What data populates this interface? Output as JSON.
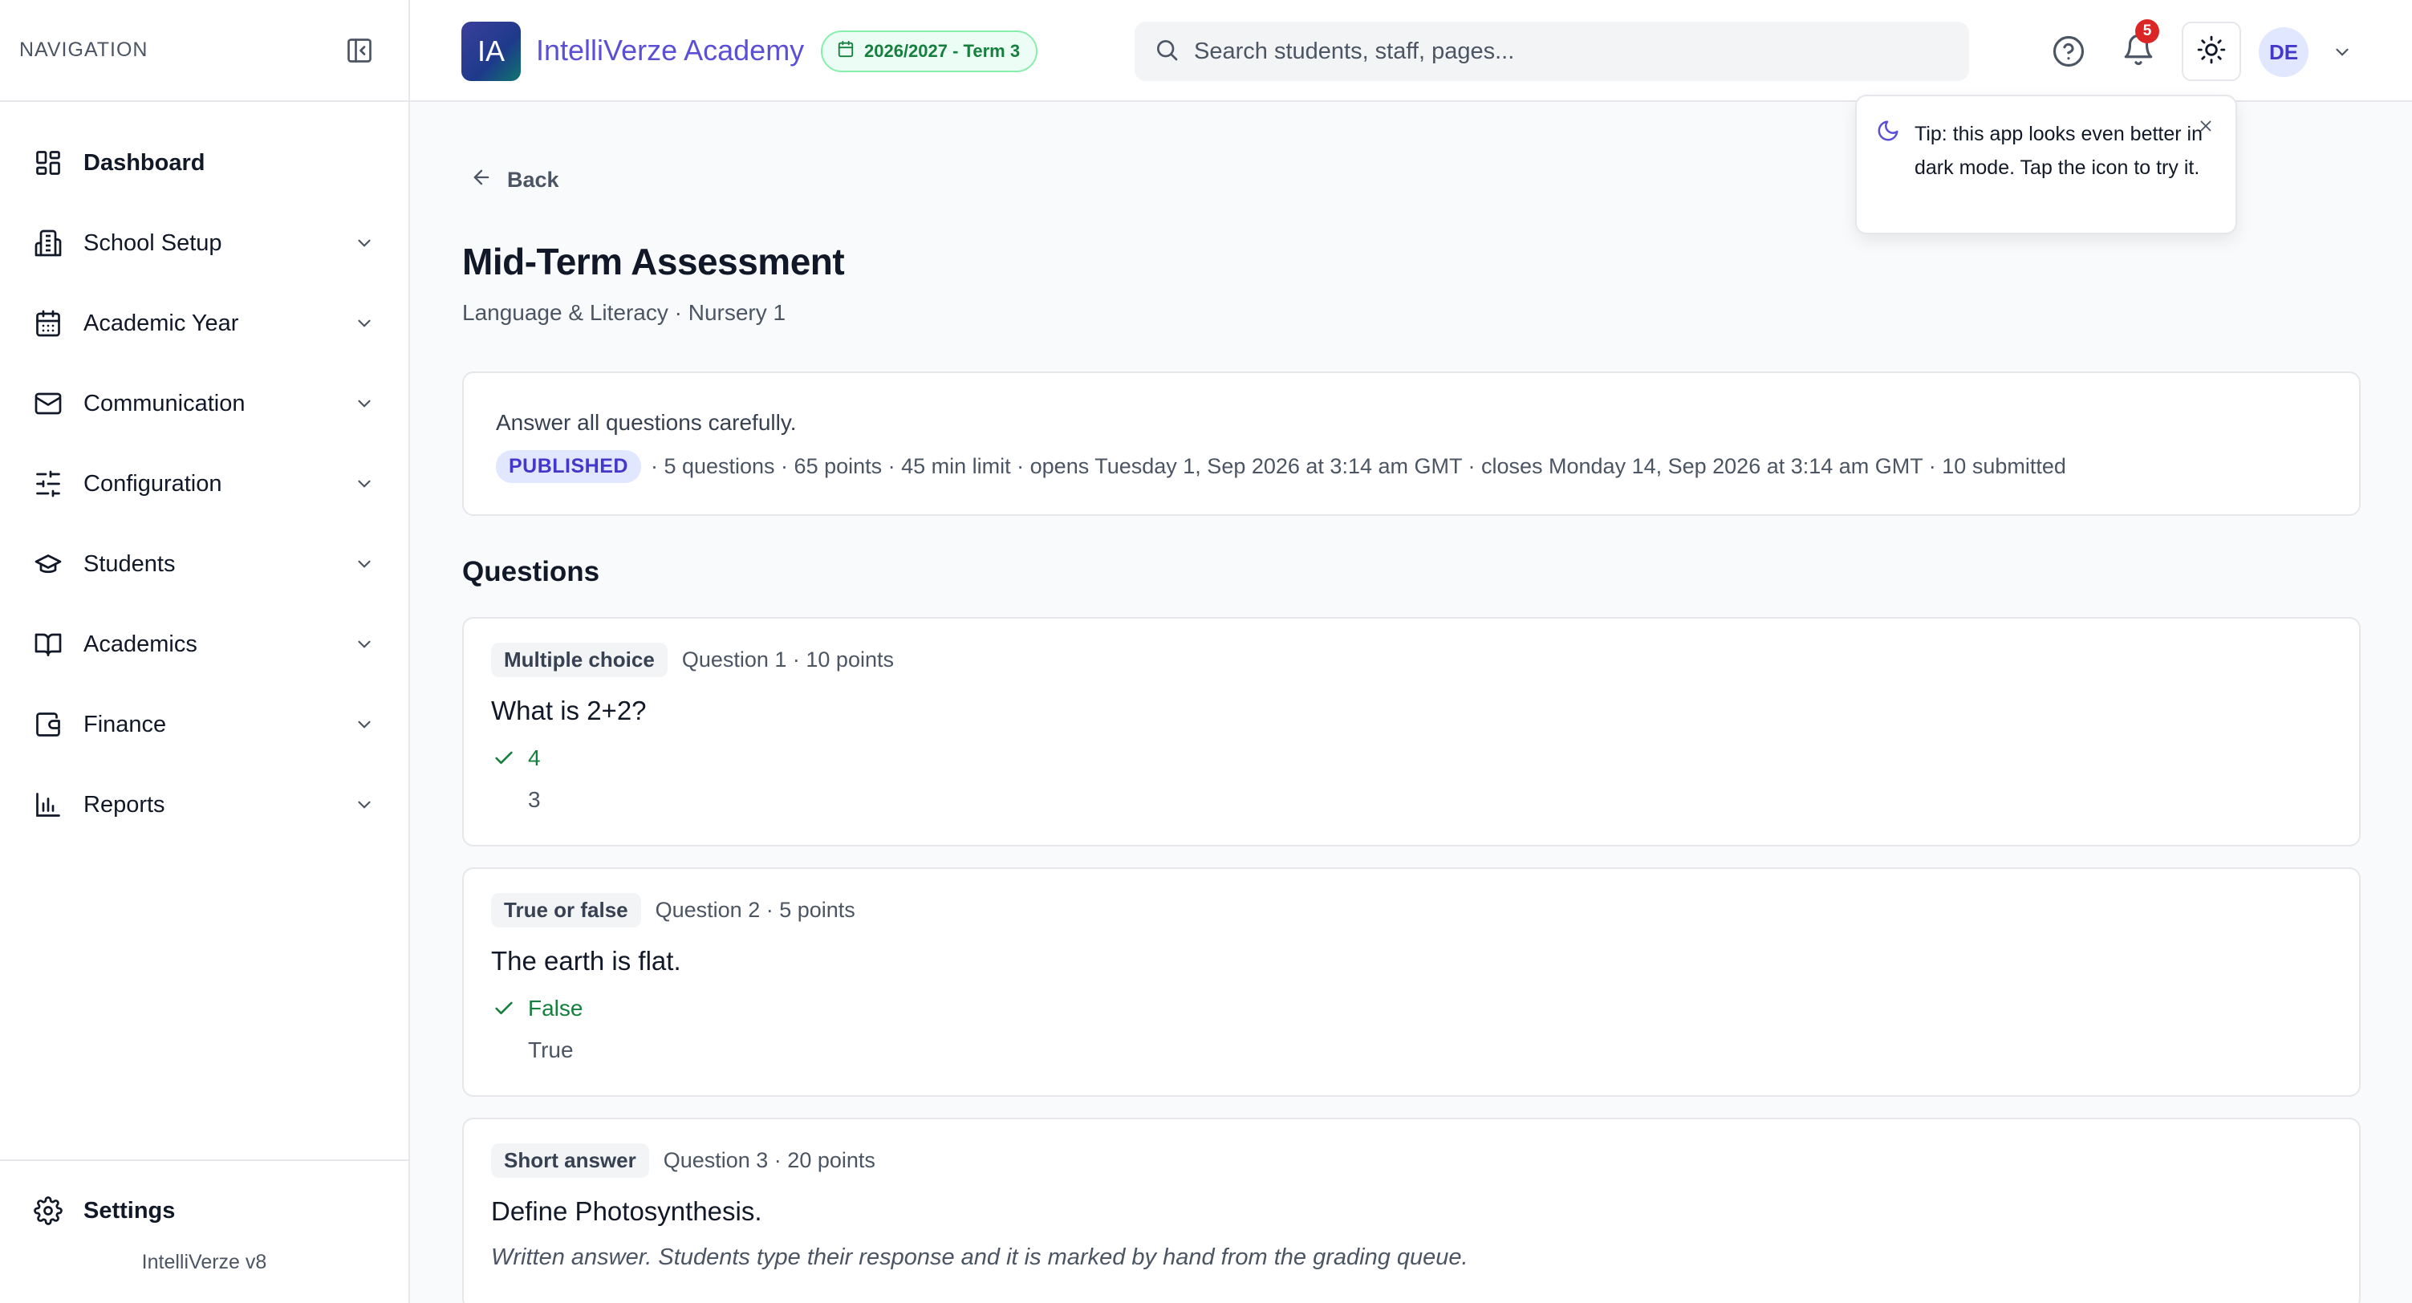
{
  "sidebar": {
    "title": "NAVIGATION",
    "items": [
      {
        "label": "Dashboard",
        "icon": "dashboard-icon"
      },
      {
        "label": "School Setup",
        "icon": "building-icon"
      },
      {
        "label": "Academic Year",
        "icon": "calendar-icon"
      },
      {
        "label": "Communication",
        "icon": "mail-icon"
      },
      {
        "label": "Configuration",
        "icon": "sliders-icon"
      },
      {
        "label": "Students",
        "icon": "graduation-cap-icon"
      },
      {
        "label": "Academics",
        "icon": "book-icon"
      },
      {
        "label": "Finance",
        "icon": "wallet-icon"
      },
      {
        "label": "Reports",
        "icon": "bar-chart-icon"
      }
    ],
    "settings_label": "Settings",
    "version": "IntelliVerze v8"
  },
  "header": {
    "logo_text": "IA",
    "app_name": "IntelliVerze Academy",
    "term": "2026/2027 - Term 3",
    "search_placeholder": "Search students, staff, pages...",
    "notification_count": "5",
    "avatar_initials": "DE",
    "colors": {
      "brand": "#5b4fd6",
      "term_green": "#15803d",
      "badge_red": "#dc2626"
    }
  },
  "tooltip": {
    "text": "Tip: this app looks even better in dark mode. Tap the icon to try it."
  },
  "page": {
    "back_label": "Back",
    "title": "Mid-Term Assessment",
    "subtitle": "Language & Literacy · Nursery 1",
    "description": "Answer all questions carefully.",
    "status": "PUBLISHED",
    "meta": "· 5 questions · 65 points · 45 min limit · opens Tuesday 1, Sep 2026 at 3:14 am GMT · closes Monday 14, Sep 2026 at 3:14 am GMT · 10 submitted",
    "questions_heading": "Questions"
  },
  "questions": [
    {
      "type": "Multiple choice",
      "meta": "Question 1 · 10 points",
      "text": "What is 2+2?",
      "options": [
        {
          "label": "4",
          "correct": true
        },
        {
          "label": "3",
          "correct": false
        }
      ]
    },
    {
      "type": "True or false",
      "meta": "Question 2 · 5 points",
      "text": "The earth is flat.",
      "options": [
        {
          "label": "False",
          "correct": true
        },
        {
          "label": "True",
          "correct": false
        }
      ]
    },
    {
      "type": "Short answer",
      "meta": "Question 3 · 20 points",
      "text": "Define Photosynthesis.",
      "note": "Written answer. Students type their response and it is marked by hand from the grading queue."
    }
  ]
}
